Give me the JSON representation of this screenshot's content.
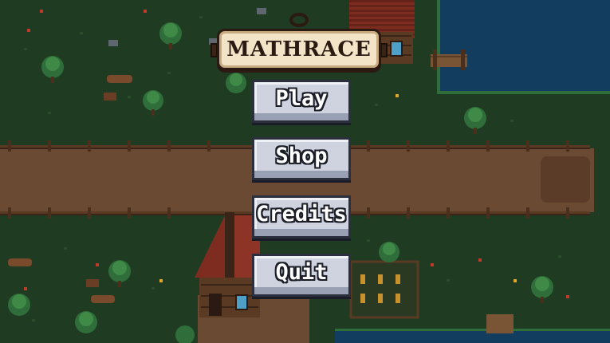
{
  "game": {
    "title": "MATHRACE"
  },
  "menu": {
    "buttons": [
      {
        "label": "Play"
      },
      {
        "label": "Shop"
      },
      {
        "label": "Credits"
      },
      {
        "label": "Quit"
      }
    ]
  },
  "colors": {
    "grass": "#1f3b22",
    "dirt_path": "#6b4a33",
    "water": "#123d5e",
    "button_face": "#cfd3df",
    "sign_parchment": "#f3e4c8"
  }
}
